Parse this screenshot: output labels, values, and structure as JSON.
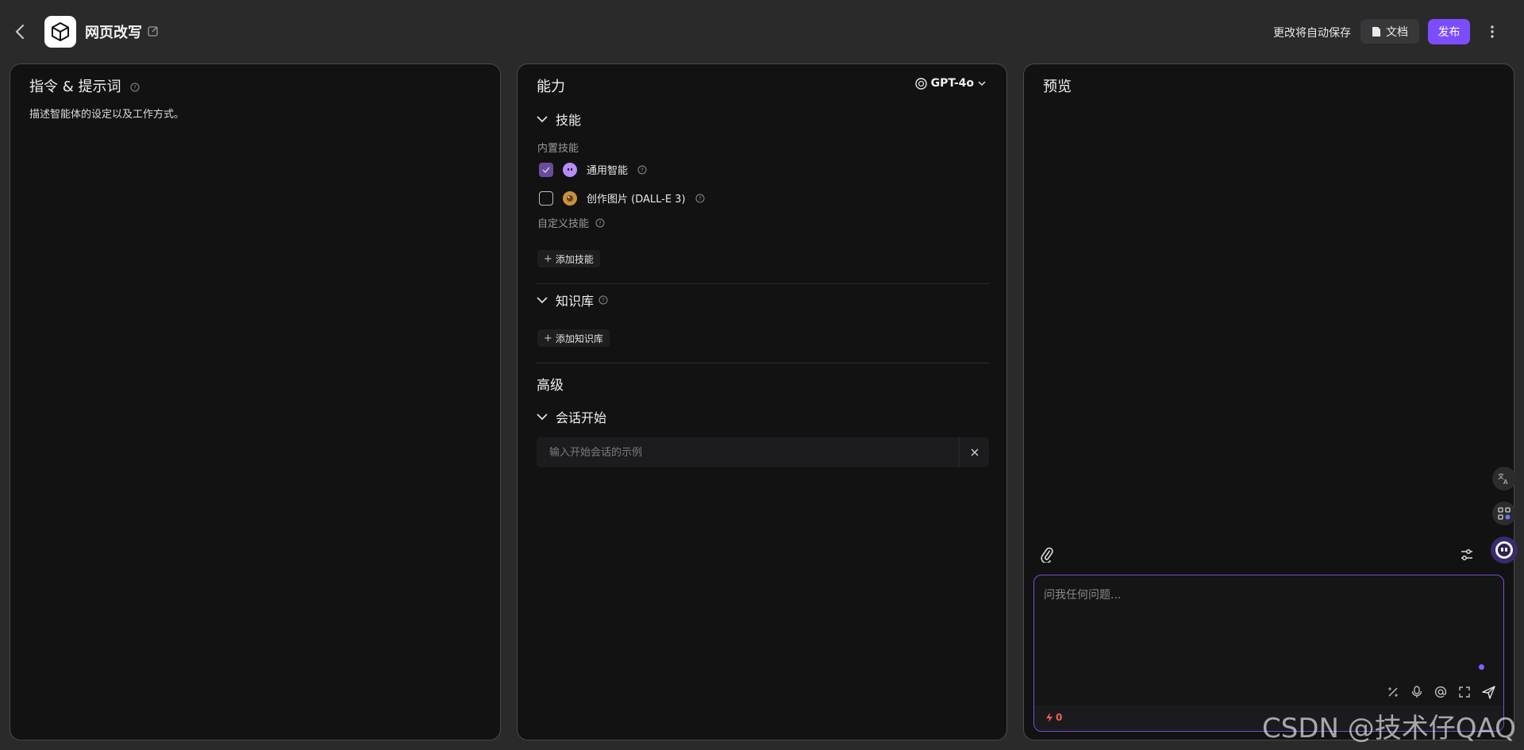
{
  "header": {
    "title": "网页改写",
    "autosave_text": "更改将自动保存",
    "docs_label": "文档",
    "publish_label": "发布"
  },
  "instructions_panel": {
    "title": "指令 & 提示词",
    "description": "描述智能体的设定以及工作方式。"
  },
  "capabilities_panel": {
    "title": "能力",
    "model": "GPT-4o",
    "skills": {
      "title": "技能",
      "builtin_label": "内置技能",
      "items": [
        {
          "label": "通用智能",
          "checked": true
        },
        {
          "label": "创作图片 (DALL-E 3)",
          "checked": false
        }
      ],
      "custom_label": "自定义技能",
      "add_label": "添加技能"
    },
    "knowledge": {
      "title": "知识库",
      "add_label": "添加知识库"
    },
    "advanced": {
      "title": "高级",
      "opener_title": "会话开始",
      "opener_placeholder": "输入开始会话的示例"
    }
  },
  "preview_panel": {
    "title": "预览",
    "chat_placeholder": "问我任何问题...",
    "credits": "0"
  },
  "watermark": "CSDN @技术仔QAQ",
  "colors": {
    "accent": "#7c4dff",
    "background": "#2a2a2b",
    "panel": "#121213"
  }
}
